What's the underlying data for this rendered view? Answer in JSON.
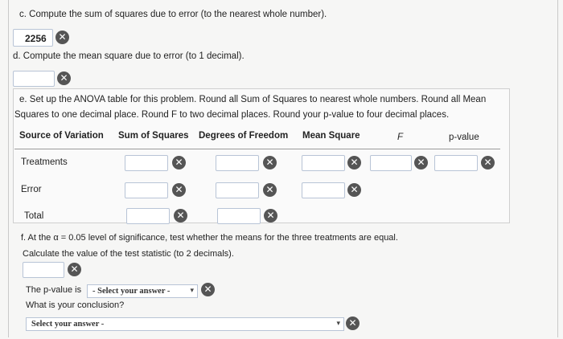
{
  "c": {
    "question": "c. Compute the sum of squares due to error (to the nearest whole number).",
    "answer": "2256"
  },
  "d": {
    "question": "d. Compute the mean square due to error (to 1 decimal)."
  },
  "e": {
    "question_line1": "e. Set up the ANOVA table for this problem. Round all Sum of Squares to nearest whole numbers. Round all Mean",
    "question_line2": "Squares to one decimal place. Round F to two decimal places. Round your p-value to four decimal places.",
    "headers": {
      "source": "Source of Variation",
      "ss": "Sum of Squares",
      "df": "Degrees of Freedom",
      "ms": "Mean Square",
      "f": "F",
      "p": "p-value"
    },
    "rows": {
      "treatments": "Treatments",
      "error": "Error",
      "total": "Total"
    }
  },
  "f": {
    "question": "f. At the α = 0.05 level of significance, test whether the means for the three treatments are equal.",
    "calc": "Calculate the value of the test statistic (to 2 decimals).",
    "pvalue_label": "The p-value is",
    "pvalue_select": "- Select your answer -",
    "conclusion_label": "What is your conclusion?",
    "conclusion_select": "Select your answer -"
  },
  "icons": {
    "wrong": "x-circle-icon",
    "caret": "chevron-down-icon"
  },
  "colors": {
    "box_border": "#b8c4d6",
    "wrong_badge": "#555555"
  }
}
